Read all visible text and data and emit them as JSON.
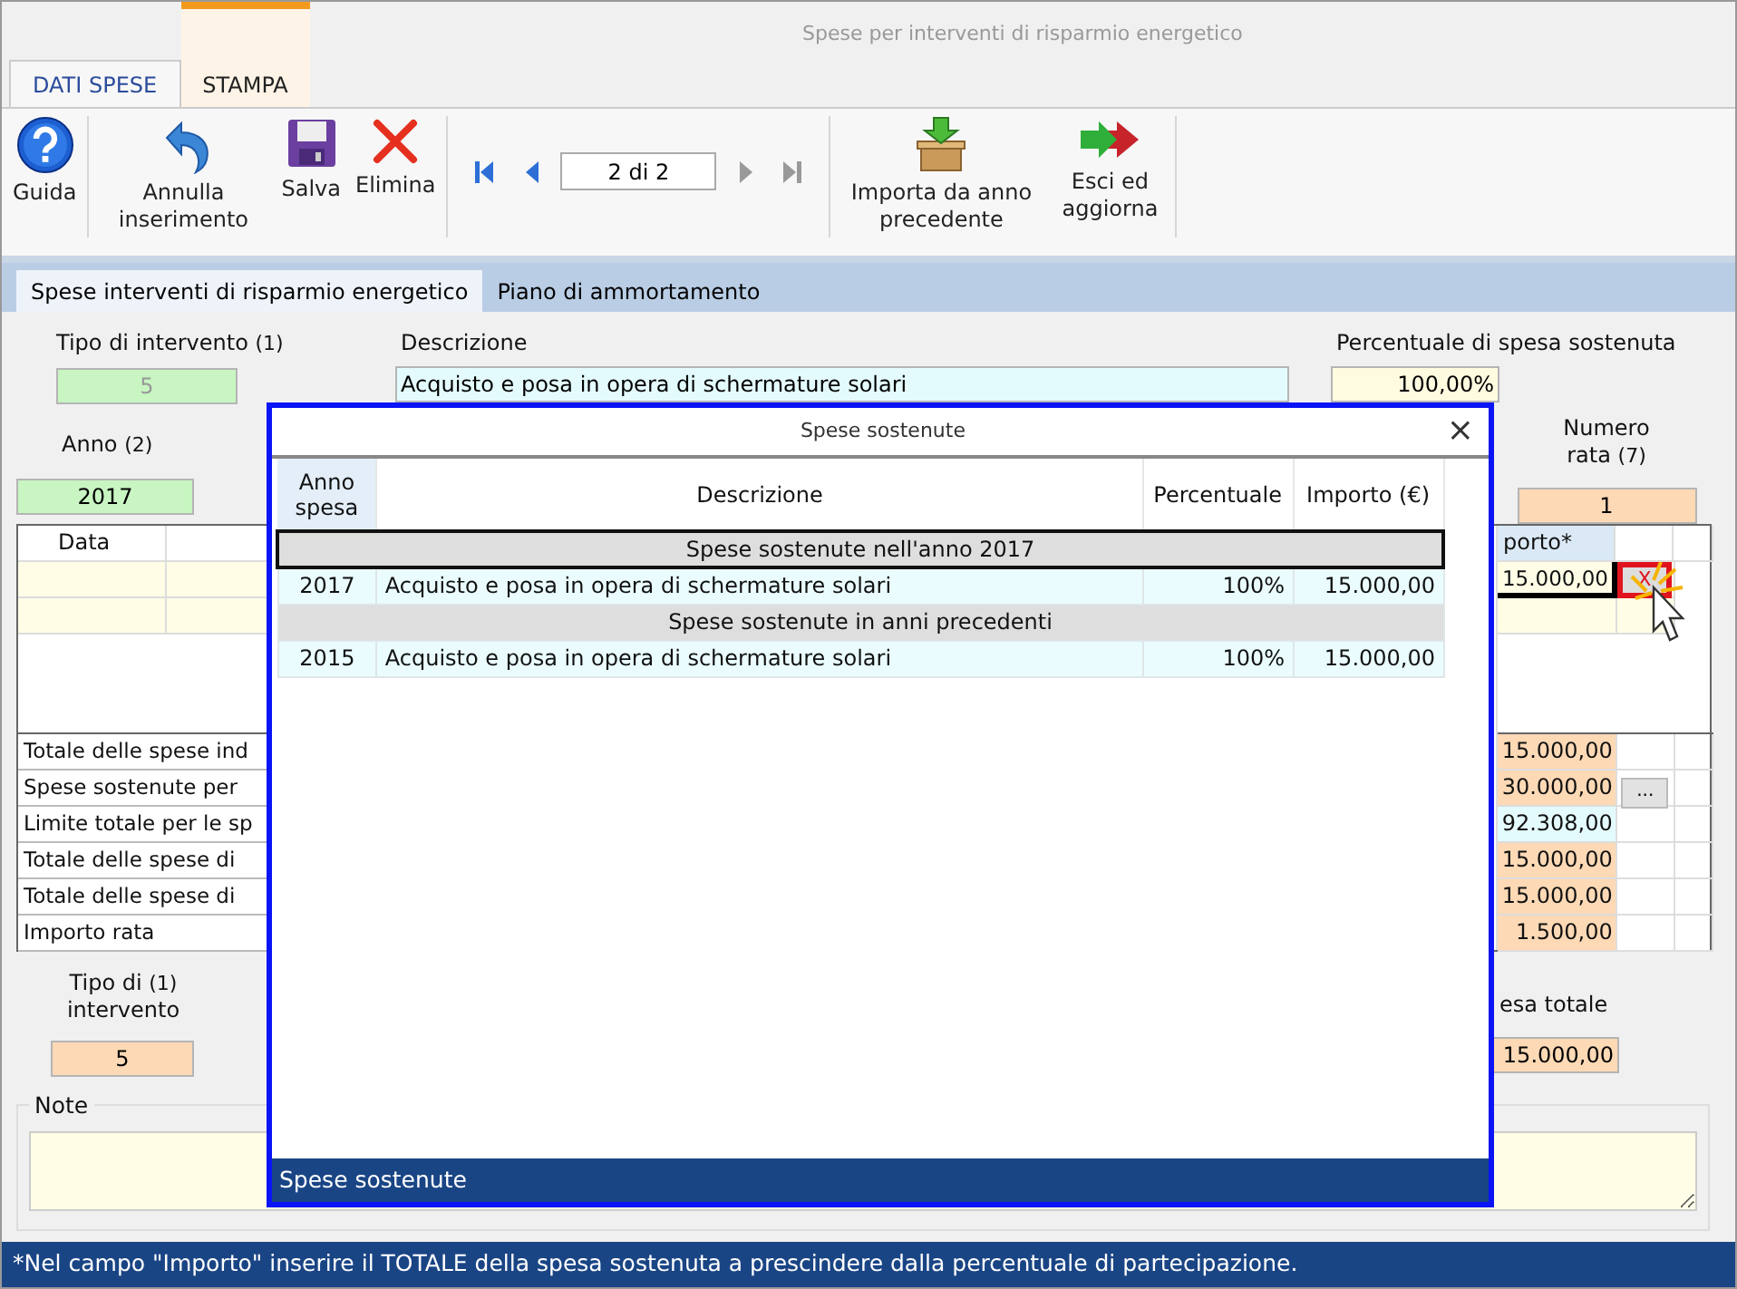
{
  "window": {
    "title": "Spese per interventi di risparmio energetico"
  },
  "ribbon_tabs": [
    {
      "label": "DATI SPESE",
      "selected": true
    },
    {
      "label": "STAMPA",
      "selected": false
    }
  ],
  "toolbar": {
    "groups": [
      [
        {
          "kind": "help",
          "label": "Guida"
        }
      ],
      [
        {
          "kind": "undo",
          "label": "Annulla inserimento"
        },
        {
          "kind": "save",
          "label": "Salva"
        },
        {
          "kind": "delete",
          "label": "Elimina"
        }
      ],
      [
        {
          "kind": "pager"
        }
      ],
      [
        {
          "kind": "import",
          "label": "Importa da anno precedente"
        },
        {
          "kind": "exit",
          "label": "Esci ed aggiorna"
        }
      ]
    ],
    "pager": {
      "value": "2 di 2",
      "buttons": [
        {
          "kind": "first",
          "disabled": false
        },
        {
          "kind": "prev",
          "disabled": false
        },
        {
          "kind": "next",
          "disabled": true
        },
        {
          "kind": "last",
          "disabled": true
        }
      ]
    }
  },
  "form_tabs": [
    {
      "label": "Spese interventi di risparmio energetico",
      "selected": true
    },
    {
      "label": "Piano di ammortamento",
      "selected": false
    }
  ],
  "form": {
    "tipo_intervento": {
      "label": "Tipo di intervento",
      "note": "(1)",
      "value": "5",
      "kind": "locked",
      "disabled": true
    },
    "descrizione": {
      "label": "Descrizione",
      "value": "Acquisto e posa in opera di schermature solari",
      "kind": "text",
      "disabled": false
    },
    "percentuale": {
      "label": "Percentuale di spesa sostenuta",
      "value": "100,00%",
      "kind": "input",
      "disabled": false
    },
    "anno": {
      "label": "Anno",
      "note": "(2)",
      "value": "2017",
      "kind": "locked",
      "disabled": false
    },
    "numero_rata": {
      "label": "Numero rata",
      "note": "(7)",
      "value": "1",
      "kind": "computed",
      "disabled": false
    },
    "grid": {
      "column_1": "Data",
      "column_importo": "porto*",
      "rows": [
        {
          "kind": "filled",
          "importo": "15.000,00",
          "delete_button": "X"
        },
        {
          "kind": "empty"
        }
      ]
    },
    "summary": [
      {
        "label": "Totale delle spese ind",
        "value": "15.000,00",
        "kind": "computed"
      },
      {
        "label": "Spese sostenute per",
        "value": "30.000,00",
        "kind": "computed",
        "button": "..."
      },
      {
        "label": "Limite totale per le sp",
        "value": "92.308,00",
        "kind": "text"
      },
      {
        "label": "Totale delle spese di",
        "value": "15.000,00",
        "kind": "computed"
      },
      {
        "label": "Totale delle spese di",
        "value": "15.000,00",
        "kind": "computed"
      },
      {
        "label": "Importo rata",
        "value": "1.500,00",
        "kind": "computed"
      }
    ],
    "tipo_intervento_2": {
      "label": "Tipo di",
      "label_line_2": "intervento",
      "note": "(1)",
      "value": "5",
      "kind": "computed",
      "disabled": false
    },
    "spesa_totale": {
      "label": "esa totale",
      "value": "15.000,00",
      "kind": "computed",
      "disabled": false
    },
    "note": {
      "label": "Note"
    }
  },
  "dialog": {
    "title": "Spese sostenute",
    "close": "×",
    "columns": [
      "Anno spesa",
      "Descrizione",
      "Percentuale",
      "Importo (€)"
    ],
    "sections": [
      {
        "title": "Spese sostenute nell'anno 2017",
        "selected": true,
        "rows": [
          [
            "2017",
            "Acquisto e posa in opera di schermature solari",
            "100%",
            "15.000,00"
          ]
        ]
      },
      {
        "title": "Spese sostenute in anni precedenti",
        "selected": false,
        "rows": [
          [
            "2015",
            "Acquisto e posa in opera di schermature solari",
            "100%",
            "15.000,00"
          ]
        ]
      }
    ],
    "status": "Spese sostenute"
  },
  "status_bar": "*Nel campo \"Importo\" inserire il TOTALE della spesa sostenuta a prescindere dalla percentuale di partecipazione."
}
